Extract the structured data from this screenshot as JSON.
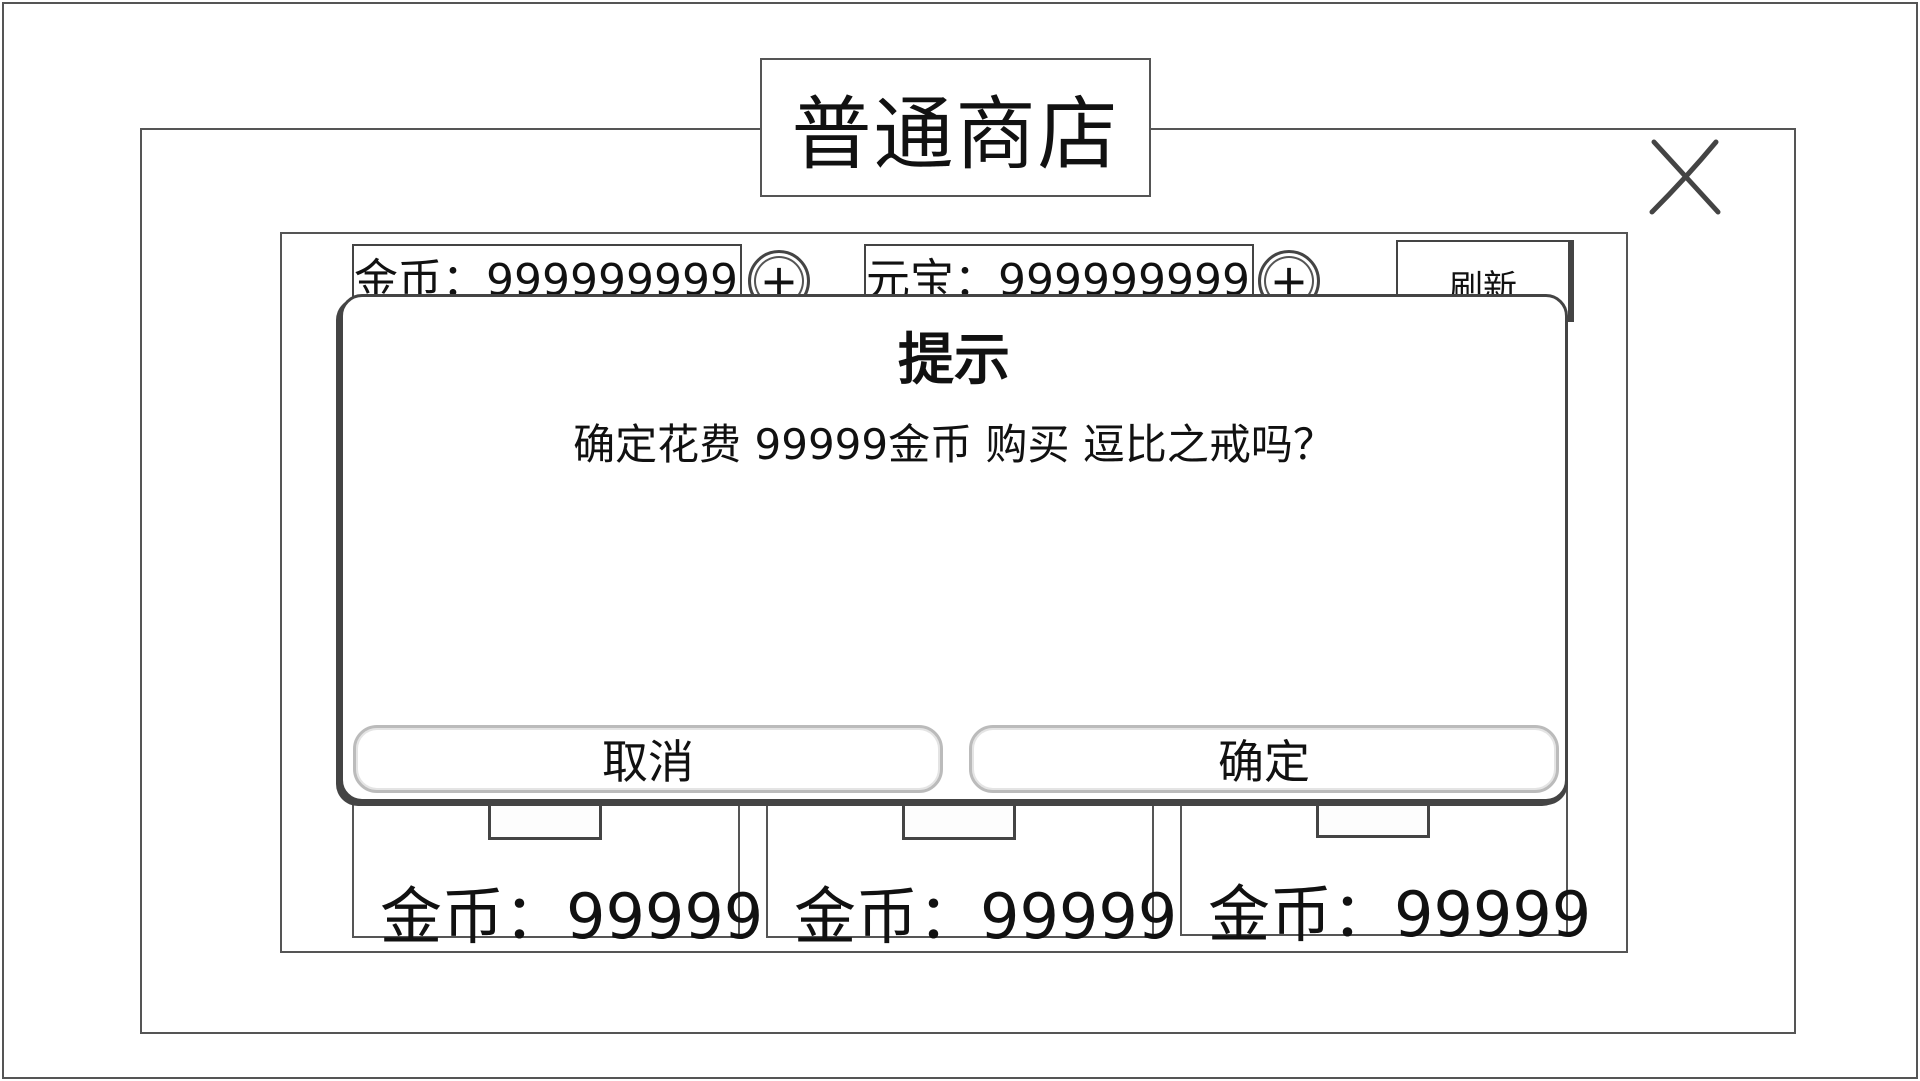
{
  "shop": {
    "title": "普通商店",
    "close_glyph": "X",
    "currencies": [
      {
        "label": "金币：999999999",
        "icon": "plus-icon",
        "glyph": "+"
      },
      {
        "label": "元宝：999999999",
        "icon": "plus-icon",
        "glyph": "+"
      }
    ],
    "refresh_label": "刷新",
    "items": [
      {
        "price": "金币：99999"
      },
      {
        "price": "金币：99999"
      },
      {
        "price": "金币：99999"
      }
    ]
  },
  "dialog": {
    "title": "提示",
    "message": "确定花费 99999金币 购买 逗比之戒吗？",
    "cancel_label": "取消",
    "confirm_label": "确定"
  }
}
